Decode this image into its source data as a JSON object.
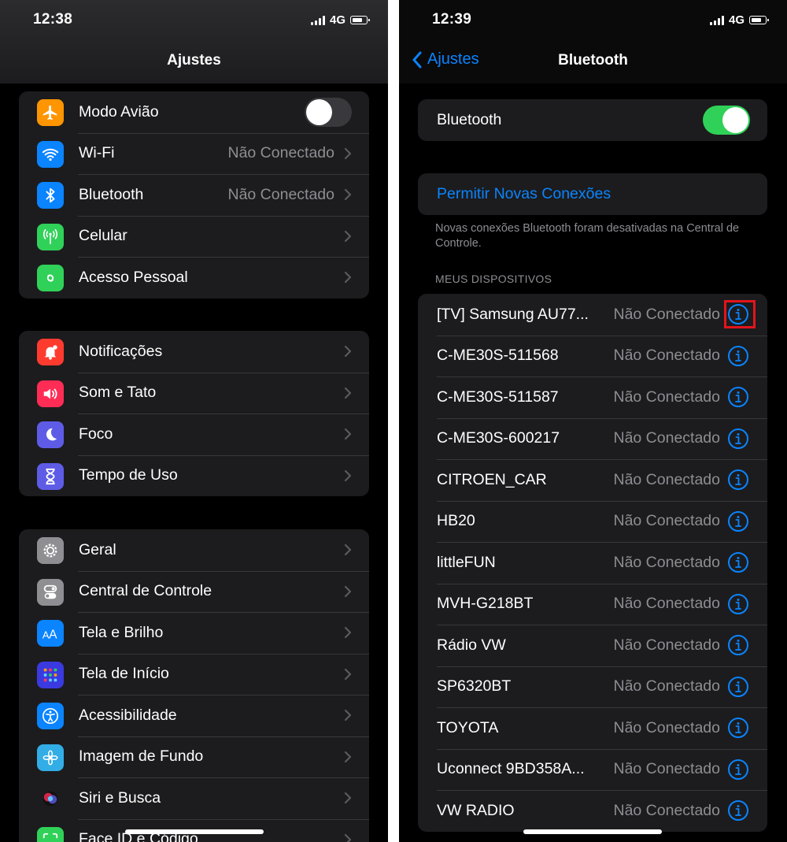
{
  "left": {
    "status": {
      "time": "12:38",
      "network": "4G"
    },
    "title": "Ajustes",
    "groups": [
      [
        {
          "label": "Modo Avião",
          "icon": "airplane-icon",
          "color": "#ff9500",
          "toggle": "off"
        },
        {
          "label": "Wi-Fi",
          "icon": "wifi-icon",
          "color": "#0a84ff",
          "value": "Não Conectado"
        },
        {
          "label": "Bluetooth",
          "icon": "bluetooth-icon",
          "color": "#0a84ff",
          "value": "Não Conectado"
        },
        {
          "label": "Celular",
          "icon": "cellular-icon",
          "color": "#30d158"
        },
        {
          "label": "Acesso Pessoal",
          "icon": "hotspot-icon",
          "color": "#30d158"
        }
      ],
      [
        {
          "label": "Notificações",
          "icon": "bell-icon",
          "color": "#ff3b30"
        },
        {
          "label": "Som e Tato",
          "icon": "speaker-icon",
          "color": "#ff2d55"
        },
        {
          "label": "Foco",
          "icon": "moon-icon",
          "color": "#5e5ce6"
        },
        {
          "label": "Tempo de Uso",
          "icon": "hourglass-icon",
          "color": "#5e5ce6"
        }
      ],
      [
        {
          "label": "Geral",
          "icon": "gear-icon",
          "color": "#8e8e93"
        },
        {
          "label": "Central de Controle",
          "icon": "switches-icon",
          "color": "#8e8e93"
        },
        {
          "label": "Tela e Brilho",
          "icon": "text-size-icon",
          "color": "#0a84ff"
        },
        {
          "label": "Tela de Início",
          "icon": "home-grid-icon",
          "color": "#3a3ae0"
        },
        {
          "label": "Acessibilidade",
          "icon": "accessibility-icon",
          "color": "#0a84ff"
        },
        {
          "label": "Imagem de Fundo",
          "icon": "flower-icon",
          "color": "#32ade6"
        },
        {
          "label": "Siri e Busca",
          "icon": "siri-icon",
          "color": "#1c1c1e"
        },
        {
          "label": "Face ID e Código",
          "icon": "faceid-icon",
          "color": "#30d158"
        }
      ]
    ]
  },
  "right": {
    "status": {
      "time": "12:39",
      "network": "4G"
    },
    "back_label": "Ajustes",
    "title": "Bluetooth",
    "bluetooth_label": "Bluetooth",
    "bluetooth_toggle": "on",
    "allow_label": "Permitir Novas Conexões",
    "footnote": "Novas conexões Bluetooth foram desativadas na Central de Controle.",
    "section_header": "MEUS DISPOSITIVOS",
    "devices": [
      {
        "name": "[TV] Samsung AU77...",
        "status": "Não Conectado"
      },
      {
        "name": "C-ME30S-511568",
        "status": "Não Conectado"
      },
      {
        "name": "C-ME30S-511587",
        "status": "Não Conectado"
      },
      {
        "name": "C-ME30S-600217",
        "status": "Não Conectado"
      },
      {
        "name": "CITROEN_CAR",
        "status": "Não Conectado"
      },
      {
        "name": "HB20",
        "status": "Não Conectado"
      },
      {
        "name": "littleFUN",
        "status": "Não Conectado"
      },
      {
        "name": "MVH-G218BT",
        "status": "Não Conectado"
      },
      {
        "name": "Rádio VW",
        "status": "Não Conectado"
      },
      {
        "name": "SP6320BT",
        "status": "Não Conectado"
      },
      {
        "name": "TOYOTA",
        "status": "Não Conectado"
      },
      {
        "name": "Uconnect 9BD358A...",
        "status": "Não Conectado"
      },
      {
        "name": "VW RADIO",
        "status": "Não Conectado"
      }
    ],
    "highlight_color": "#e3141b"
  },
  "colors": {
    "accent": "#0a84ff",
    "toggle_on": "#30d158",
    "cell_bg": "#1c1c1e",
    "secondary_text": "#8d8d93"
  }
}
